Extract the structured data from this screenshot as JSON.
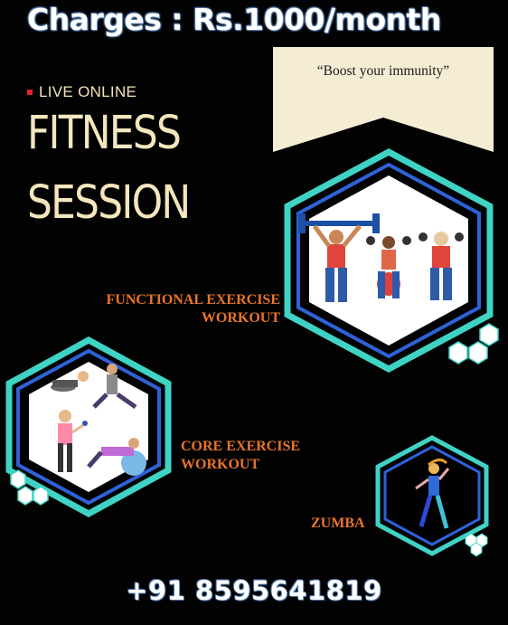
{
  "header": {
    "charges": "Charges : Rs.1000/month"
  },
  "banner": {
    "quote": "“Boost your immunity”"
  },
  "live": {
    "tag": "LIVE ONLINE"
  },
  "title": {
    "line1": "FITNESS",
    "line2": "SESSION"
  },
  "workouts": {
    "functional": {
      "line1": "FUNCTIONAL EXERCISE",
      "line2": "WORKOUT"
    },
    "core": {
      "line1": "CORE EXERCISE",
      "line2": "WORKOUT"
    },
    "zumba": {
      "line1": "ZUMBA"
    }
  },
  "contact": {
    "phone": "+91 8595641819"
  },
  "colors": {
    "background": "#020202",
    "title": "#f4e6bd",
    "label": "#e8742a",
    "hex_teal": "#3fd3c4",
    "hex_blue": "#2f62d8",
    "live_dot": "#e0232b"
  },
  "icons": [
    "barbell-lifters-illustration",
    "core-exercise-illustration",
    "zumba-dancer-illustration"
  ]
}
